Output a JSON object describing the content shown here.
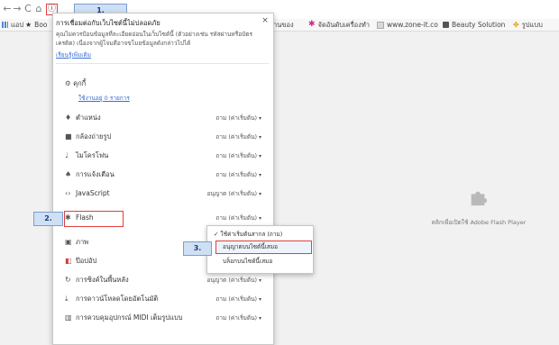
{
  "browser": {
    "back": "←",
    "forward": "→",
    "reload": "C",
    "home": "⌂",
    "info": "ⓘ",
    "bookmarks": [
      {
        "label": "แอป",
        "icon": "apps-grid-icon"
      },
      {
        "label": "Boo",
        "icon": "star-icon"
      },
      {
        "label": "านของ",
        "icon": ""
      },
      {
        "label": "จัดอันดับเครื่องทำ",
        "icon": "flower-icon"
      },
      {
        "label": "www.zone-it.co",
        "icon": "zone-icon"
      },
      {
        "label": "Beauty Solution",
        "icon": "beauty-icon"
      },
      {
        "label": "รูปแบบ",
        "icon": "leaf-icon"
      }
    ]
  },
  "popup": {
    "close": "×",
    "warning_title": "การเชื่อมต่อกับเว็บไซต์นี้ไม่ปลอดภัย",
    "warning_desc": "คุณไม่ควรป้อนข้อมูลที่ละเอียดอ่อนในเว็บไซต์นี้ (ตัวอย่างเช่น รหัสผ่านหรือบัตรเครดิต) เนื่องจากผู้โจมตีอาจขโมยข้อมูลดังกล่าวไปได้",
    "warning_link": "เรียนรู้เพิ่มเติม",
    "cookies_label": "คุกกี้",
    "cookies_link": "ใช้งานอยู่ 0 รายการ",
    "rows": [
      {
        "icon": "location-pin-icon",
        "label": "ตำแหน่ง",
        "value": "ถาม (ค่าเริ่มต้น)"
      },
      {
        "icon": "camera-icon",
        "label": "กล้องถ่ายรูป",
        "value": "ถาม (ค่าเริ่มต้น)"
      },
      {
        "icon": "microphone-icon",
        "label": "ไมโครโฟน",
        "value": "ถาม (ค่าเริ่มต้น)"
      },
      {
        "icon": "bell-icon",
        "label": "การแจ้งเตือน",
        "value": "ถาม (ค่าเริ่มต้น)"
      },
      {
        "icon": "code-icon",
        "label": "JavaScript",
        "value": "อนุญาต (ค่าเริ่มต้น)"
      },
      {
        "icon": "puzzle-icon",
        "label": "Flash",
        "value": "ถาม (ค่าเริ่มต้น)"
      },
      {
        "icon": "image-icon",
        "label": "ภาพ",
        "value": ""
      },
      {
        "icon": "popup-icon",
        "label": "ป๊อปอัป",
        "value": ""
      },
      {
        "icon": "sync-icon",
        "label": "การซิงค์ในพื้นหลัง",
        "value": "อนุญาต (ค่าเริ่มต้น)"
      },
      {
        "icon": "download-icon",
        "label": "การดาวน์โหลดโดยอัตโนมัติ",
        "value": "ถาม (ค่าเริ่มต้น)"
      },
      {
        "icon": "midi-icon",
        "label": "การควบคุมอุปกรณ์ MIDI เต็มรูปแบบ",
        "value": "ถาม (ค่าเริ่มต้น)"
      }
    ]
  },
  "dropdown": {
    "options": [
      {
        "label": "ใช้ค่าเริ่มต้นสากล (ถาม)",
        "checked": "✓"
      },
      {
        "label": "อนุญาตบนไซต์นี้เสมอ",
        "checked": ""
      },
      {
        "label": "บล็อกบนไซต์นี้เสมอ",
        "checked": ""
      }
    ]
  },
  "plugin": {
    "message": "คลิกเพื่อเปิดใช้ Adobe Flash Player"
  },
  "annotations": {
    "step1": "1.",
    "step2": "2.",
    "step3": "3."
  },
  "colors": {
    "highlight": "#e04040",
    "tag_bg": "#cfe0f5",
    "link": "#3a6fd6"
  }
}
